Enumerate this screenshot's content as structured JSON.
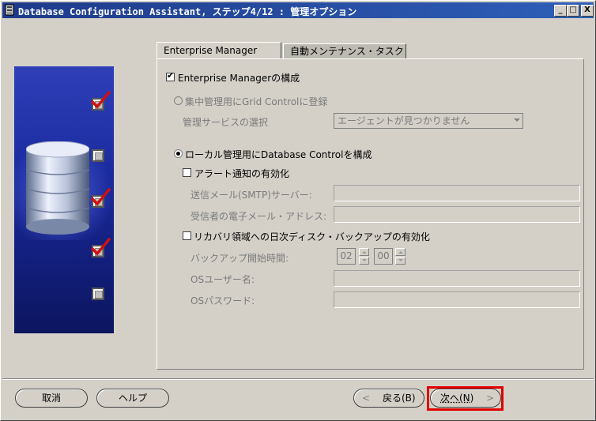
{
  "window": {
    "title": "Database Configuration Assistant, ステップ4/12 : 管理オプション",
    "controls": {
      "minimize": "_",
      "maximize": "□",
      "close": "X"
    }
  },
  "tabs": [
    {
      "label": "Enterprise Manager",
      "active": true
    },
    {
      "label": "自動メンテナンス・タスク",
      "active": false
    }
  ],
  "em": {
    "configure_label": "Enterprise Managerの構成",
    "configure_checked": true,
    "grid_radio_label": "集中管理用にGrid Controlに登録",
    "grid_radio_selected": false,
    "mgmt_service_label": "管理サービスの選択",
    "mgmt_service_value": "エージェントが見つかりません",
    "local_radio_label": "ローカル管理用にDatabase Controlを構成",
    "local_radio_selected": true,
    "alert_label": "アラート通知の有効化",
    "alert_checked": false,
    "smtp_label": "送信メール(SMTP)サーバー:",
    "smtp_value": "",
    "recipient_label": "受信者の電子メール・アドレス:",
    "recipient_value": "",
    "backup_label": "リカバリ領域への日次ディスク・バックアップの有効化",
    "backup_checked": false,
    "backup_time_label": "バックアップ開始時間:",
    "backup_hour": "02",
    "backup_minute": "00",
    "os_user_label": "OSユーザー名:",
    "os_user_value": "",
    "os_password_label": "OSパスワード:",
    "os_password_value": ""
  },
  "steps": [
    {
      "state": "done"
    },
    {
      "state": "pending"
    },
    {
      "state": "done"
    },
    {
      "state": "done"
    },
    {
      "state": "pending"
    }
  ],
  "buttons": {
    "cancel": "取消",
    "help": "ヘルプ",
    "back": "戻る(B)",
    "next": "次へ(N)"
  },
  "colors": {
    "side_panel": "#1a2a9e",
    "check_red": "#d01010",
    "highlight": "#e00000",
    "titlebar": "#1e3a8a"
  }
}
